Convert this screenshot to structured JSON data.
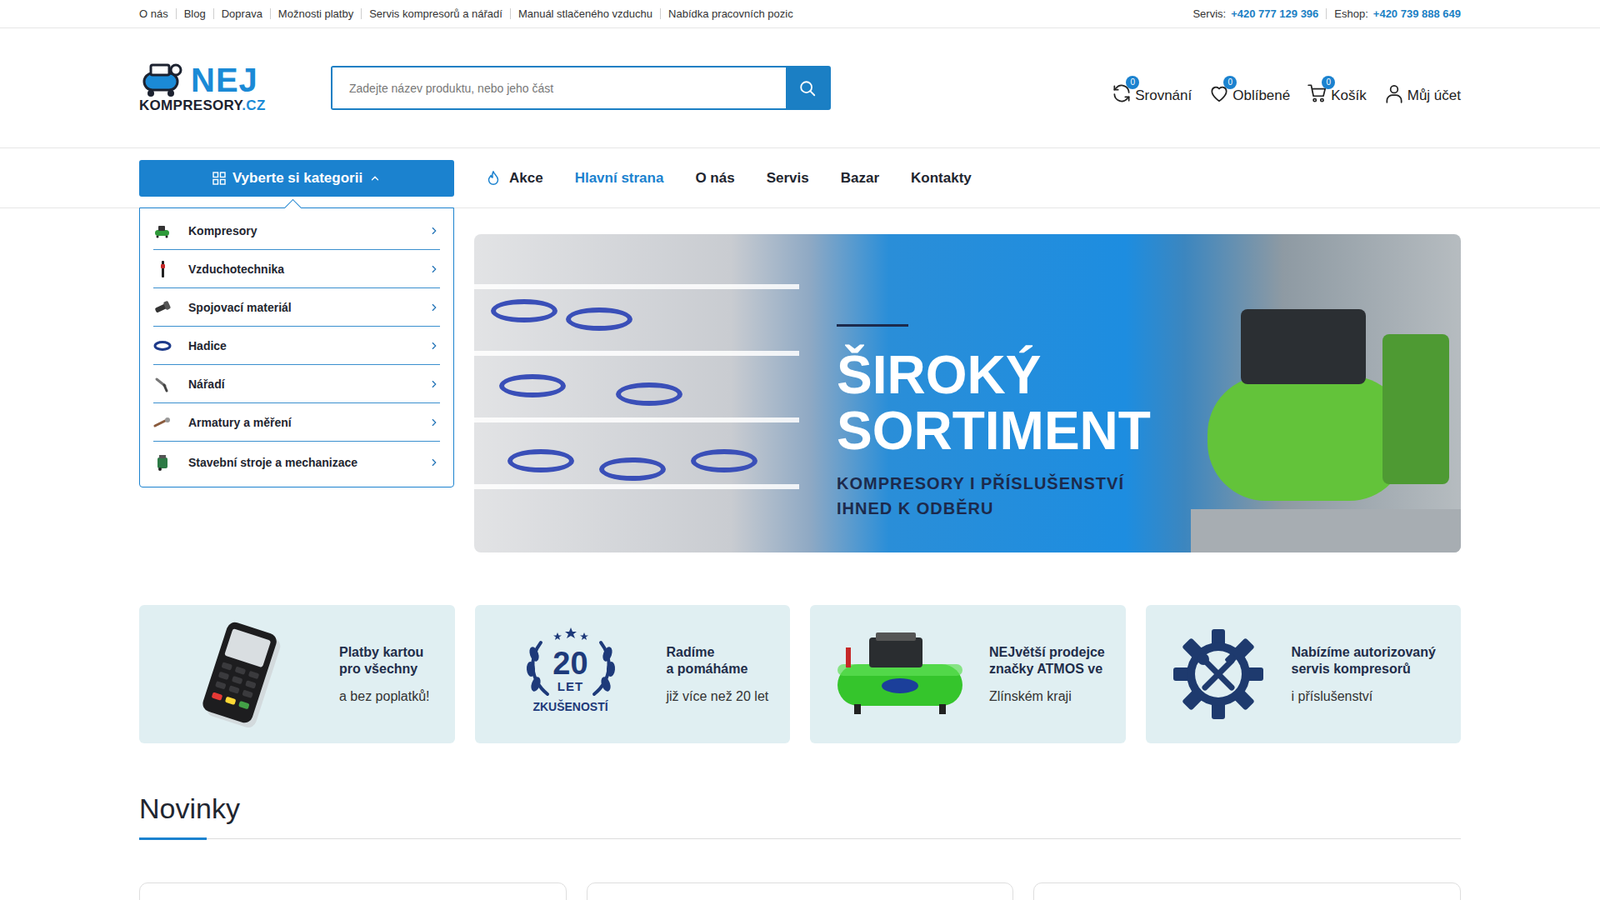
{
  "topbar": {
    "links": [
      {
        "label": "O nás"
      },
      {
        "label": "Blog"
      },
      {
        "label": "Doprava"
      },
      {
        "label": "Možnosti platby"
      },
      {
        "label": "Servis kompresorů a nářadí"
      },
      {
        "label": "Manuál stlačeného vzduchu"
      },
      {
        "label": "Nabídka pracovních pozic"
      }
    ],
    "contacts": [
      {
        "label": "Servis:",
        "phone": "+420 777 129 396"
      },
      {
        "label": "Eshop:",
        "phone": "+420 739 888 649"
      }
    ]
  },
  "logo": {
    "top": "NEJ",
    "bottom": "KOMPRESORY",
    "suffix": ".CZ"
  },
  "search": {
    "placeholder": "Zadejte název produktu, nebo jeho část"
  },
  "header_actions": [
    {
      "label": "Srovnání",
      "count": "0",
      "kind": "compare"
    },
    {
      "label": "Oblíbené",
      "count": "0",
      "kind": "favorite"
    },
    {
      "label": "Košík",
      "count": "0",
      "kind": "cart"
    },
    {
      "label": "Můj účet",
      "kind": "account"
    }
  ],
  "category_button": {
    "label": "Vyberte si kategorii",
    "expanded": true
  },
  "nav": [
    {
      "label": "Akce",
      "selected": false,
      "kind": "promo"
    },
    {
      "label": "Hlavní strana",
      "selected": true,
      "kind": "link"
    },
    {
      "label": "O nás",
      "selected": false,
      "kind": "link"
    },
    {
      "label": "Servis",
      "selected": false,
      "kind": "link"
    },
    {
      "label": "Bazar",
      "selected": false,
      "kind": "link"
    },
    {
      "label": "Kontakty",
      "selected": false,
      "kind": "link"
    }
  ],
  "categories": [
    {
      "label": "Kompresory",
      "kind": "compressor"
    },
    {
      "label": "Vzduchotechnika",
      "kind": "air"
    },
    {
      "label": "Spojovací materiál",
      "kind": "connector"
    },
    {
      "label": "Hadice",
      "kind": "hose"
    },
    {
      "label": "Nářadí",
      "kind": "tool"
    },
    {
      "label": "Armatury a měření",
      "kind": "gauge"
    },
    {
      "label": "Stavební stroje a mechanizace",
      "kind": "machine"
    }
  ],
  "banner": {
    "title_lines": [
      "ŠIROKÝ",
      "SORTIMENT"
    ],
    "subtitle_lines": [
      "KOMPRESORY I PŘÍSLUŠENSTVÍ",
      "IHNED K ODBĚRU"
    ]
  },
  "features": [
    {
      "title_lines": [
        "Platby kartou",
        "pro všechny"
      ],
      "subtitle": "a bez poplatků!",
      "kind": "terminal"
    },
    {
      "title_lines": [
        "Radíme",
        "a pomáháme"
      ],
      "subtitle": "již více než 20 let",
      "kind": "badge",
      "badge": [
        "20",
        "LET",
        "ZKUŠENOSTÍ"
      ]
    },
    {
      "title_lines": [
        "NEJvětší prodejce",
        "značky ATMOS ve"
      ],
      "subtitle": "Zlínském kraji",
      "kind": "compressor"
    },
    {
      "title_lines": [
        "Nabízíme autorizovaný",
        "servis kompresorů"
      ],
      "subtitle": "i příslušenství",
      "kind": "service"
    }
  ],
  "section": {
    "title": "Novinky"
  }
}
